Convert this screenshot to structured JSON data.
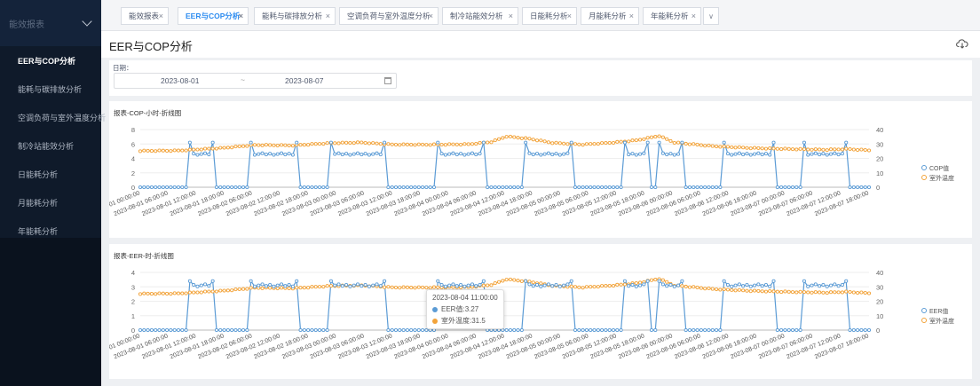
{
  "sidebar": {
    "header": "能效报表",
    "items": [
      {
        "label": "EER与COP分析",
        "active": true
      },
      {
        "label": "能耗与碳排放分析",
        "active": false
      },
      {
        "label": "空调负荷与室外温度分析",
        "active": false
      },
      {
        "label": "制冷站能效分析",
        "active": false
      },
      {
        "label": "日能耗分析",
        "active": false
      },
      {
        "label": "月能耗分析",
        "active": false
      },
      {
        "label": "年能耗分析",
        "active": false
      }
    ]
  },
  "tabs": [
    {
      "label": "能效报表",
      "active": false
    },
    {
      "label": "EER与COP分析",
      "active": true
    },
    {
      "label": "能耗与碳排放分析",
      "active": false
    },
    {
      "label": "空调负荷与室外温度分析",
      "active": false
    },
    {
      "label": "制冷站能效分析",
      "active": false
    },
    {
      "label": "日能耗分析",
      "active": false
    },
    {
      "label": "月能耗分析",
      "active": false
    },
    {
      "label": "年能耗分析",
      "active": false
    }
  ],
  "tab_close_glyph": "×",
  "tab_more_glyph": "∨",
  "page": {
    "title": "EER与COP分析",
    "download_icon": "cloud-download-icon"
  },
  "filter": {
    "label": "日期：",
    "start": "2023-08-01",
    "separator": "~",
    "end": "2023-08-07",
    "calendar_icon": "calendar-icon"
  },
  "colors": {
    "series_blue": "#5b9bd5",
    "series_orange": "#f2a33a",
    "tab_active": "#2d8cf0",
    "sidebar_bg": "#0f1a2a"
  },
  "chart_data": [
    {
      "type": "line",
      "title": "报表-COP-小时-折线图",
      "ylim_left": [
        0,
        8
      ],
      "yticks_left": [
        "0",
        "2",
        "4",
        "6",
        "8"
      ],
      "ylim_right": [
        0,
        40
      ],
      "yticks_right": [
        "0",
        "10",
        "20",
        "30",
        "40"
      ],
      "x_tick_labels": [
        "~-01 00:00:00",
        "2023-08-01 06:00:00",
        "2023-08-01 12:00:00",
        "2023-08-01 18:00:00",
        "2023-08-02 06:00:00",
        "2023-08-02 12:00:00",
        "2023-08-02 18:00:00",
        "2023-08-03 00:00:00",
        "2023-08-03 06:00:00",
        "2023-08-03 12:00:00",
        "2023-08-03 18:00:00",
        "2023-08-04 00:00:00",
        "2023-08-04 06:00:00",
        "2023-08-04 12:00:00",
        "2023-08-04 18:00:00",
        "2023-08-05 00:00:00",
        "2023-08-05 06:00:00",
        "2023-08-05 12:00:00",
        "2023-08-05 18:00:00",
        "2023-08-06 00:00:00",
        "2023-08-06 06:00:00",
        "2023-08-06 12:00:00",
        "2023-08-06 18:00:00",
        "2023-08-07 00:00:00",
        "2023-08-07 06:00:00",
        "2023-08-07 12:00:00",
        "2023-08-07 18:00:00"
      ],
      "legend": [
        "COP值",
        "室外温度"
      ],
      "legend_position": "right",
      "primary_series": "COP值",
      "working_level": 4.6,
      "spike_level": 6.2,
      "working_spans": [
        [
          13,
          19
        ],
        [
          29,
          41
        ],
        [
          50,
          64
        ],
        [
          78,
          90
        ],
        [
          101,
          113
        ],
        [
          127,
          133
        ],
        [
          136,
          142
        ],
        [
          153,
          166
        ],
        [
          174,
          185
        ]
      ],
      "temperature_profile": [
        [
          0,
          25.2
        ],
        [
          10,
          25.4
        ],
        [
          22,
          27.3
        ],
        [
          30,
          29.3
        ],
        [
          40,
          29.0
        ],
        [
          50,
          30.6
        ],
        [
          58,
          31.0
        ],
        [
          66,
          29.6
        ],
        [
          75,
          29.5
        ],
        [
          86,
          29.8
        ],
        [
          92,
          31.4
        ],
        [
          96,
          35.2
        ],
        [
          102,
          33.6
        ],
        [
          108,
          30.8
        ],
        [
          116,
          29.6
        ],
        [
          124,
          31.0
        ],
        [
          130,
          32.5
        ],
        [
          136,
          35.6
        ],
        [
          140,
          31.0
        ],
        [
          150,
          28.5
        ],
        [
          160,
          27.2
        ],
        [
          170,
          26.5
        ],
        [
          180,
          26.0
        ],
        [
          185,
          26.5
        ],
        [
          191,
          25.6
        ]
      ],
      "x_count": 192
    },
    {
      "type": "line",
      "title": "报表-EER-时-折线图",
      "ylim_left": [
        0,
        4
      ],
      "yticks_left": [
        "0",
        "1",
        "2",
        "3",
        "4"
      ],
      "ylim_right": [
        0,
        40
      ],
      "yticks_right": [
        "0",
        "10",
        "20",
        "30",
        "40"
      ],
      "x_tick_labels": [
        "~-01 00:00:00",
        "2023-08-01 06:00:00",
        "2023-08-01 12:00:00",
        "2023-08-01 18:00:00",
        "2023-08-02 06:00:00",
        "2023-08-02 12:00:00",
        "2023-08-02 18:00:00",
        "2023-08-03 00:00:00",
        "2023-08-03 06:00:00",
        "2023-08-03 12:00:00",
        "2023-08-03 18:00:00",
        "2023-08-04 00:00:00",
        "2023-08-04 06:00:00",
        "2023-08-04 12:00:00",
        "2023-08-04 18:00:00",
        "2023-08-05 00:00:00",
        "2023-08-05 06:00:00",
        "2023-08-05 12:00:00",
        "2023-08-05 18:00:00",
        "2023-08-06 00:00:00",
        "2023-08-06 06:00:00",
        "2023-08-06 12:00:00",
        "2023-08-06 18:00:00",
        "2023-08-07 00:00:00",
        "2023-08-07 06:00:00",
        "2023-08-07 12:00:00",
        "2023-08-07 18:00:00"
      ],
      "legend": [
        "EER值",
        "室外温度"
      ],
      "legend_position": "right",
      "primary_series": "EER值",
      "working_level": 3.1,
      "spike_level": 3.4,
      "working_spans": [
        [
          13,
          19
        ],
        [
          29,
          41
        ],
        [
          50,
          64
        ],
        [
          78,
          90
        ],
        [
          101,
          113
        ],
        [
          127,
          133
        ],
        [
          136,
          142
        ],
        [
          153,
          166
        ],
        [
          174,
          185
        ]
      ],
      "temperature_profile": [
        [
          0,
          25.2
        ],
        [
          10,
          25.4
        ],
        [
          22,
          27.3
        ],
        [
          30,
          29.3
        ],
        [
          40,
          29.0
        ],
        [
          50,
          30.6
        ],
        [
          58,
          31.0
        ],
        [
          66,
          29.6
        ],
        [
          75,
          29.5
        ],
        [
          86,
          29.8
        ],
        [
          92,
          31.4
        ],
        [
          96,
          35.2
        ],
        [
          102,
          33.6
        ],
        [
          108,
          30.8
        ],
        [
          116,
          29.6
        ],
        [
          124,
          31.0
        ],
        [
          130,
          32.5
        ],
        [
          136,
          35.6
        ],
        [
          140,
          31.0
        ],
        [
          150,
          28.5
        ],
        [
          160,
          27.2
        ],
        [
          170,
          26.5
        ],
        [
          180,
          26.0
        ],
        [
          185,
          26.5
        ],
        [
          191,
          25.6
        ]
      ],
      "x_count": 192,
      "tooltip": {
        "title": "2023-08-04 11:00:00",
        "rows": [
          {
            "label": "EER值",
            "value": "3.27"
          },
          {
            "label": "室外温度",
            "value": "31.5"
          }
        ]
      }
    }
  ]
}
